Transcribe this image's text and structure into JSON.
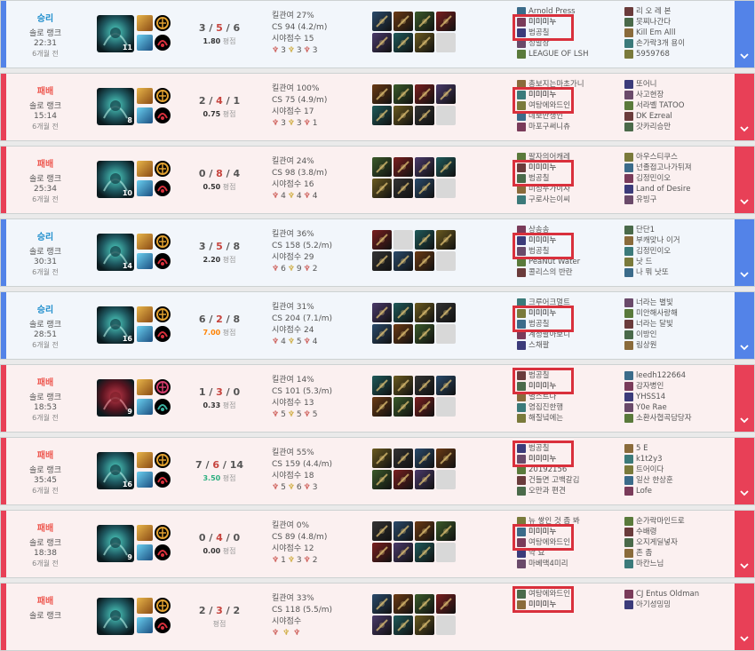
{
  "labels": {
    "kill_participation": "킬관여",
    "cs": "CS",
    "vision": "시야점수",
    "avg_suffix": "평점"
  },
  "colors": {
    "win": "#5383e8",
    "loss": "#e84057",
    "win_text": "#1f8ecd",
    "loss_text": "#ee5a52",
    "highlight": "#d9303c"
  },
  "matches": [
    {
      "result": "승리",
      "outcome": "win",
      "queue": "솔로 랭크",
      "duration": "22:31",
      "ago": "6개월 전",
      "level": "11",
      "champion_icon": "champion-icon",
      "kills": "3",
      "deaths": "5",
      "assists": "6",
      "kda_ratio": "1.80",
      "kda_tier": "normal",
      "kp": "27%",
      "cs": "94",
      "cs_per_min": "(4.2/m)",
      "vision_score": "15",
      "wards": [
        "3",
        "3",
        "3"
      ],
      "items": [
        "item-1",
        "item-2",
        "item-3",
        "item-4",
        "item-5",
        "item-6",
        "item-7",
        ""
      ],
      "team1": [
        {
          "name": "Arnold Press",
          "me": false
        },
        {
          "name": "미미미누",
          "me": true
        },
        {
          "name": "범공칠",
          "me": false
        },
        {
          "name": "성발장",
          "me": false
        },
        {
          "name": "LEAGUE OF LSH",
          "me": false
        }
      ],
      "team2": [
        {
          "name": "리 오 레 본",
          "me": false
        },
        {
          "name": "못찌나간다",
          "me": false
        },
        {
          "name": "Kill Em Alll",
          "me": false
        },
        {
          "name": "손가락3개 용이",
          "me": false
        },
        {
          "name": "5959768",
          "me": false
        }
      ],
      "highlight_team": 1,
      "highlight_rows": [
        1,
        2
      ]
    },
    {
      "result": "패배",
      "outcome": "loss",
      "queue": "솔로 랭크",
      "duration": "15:14",
      "ago": "6개월 전",
      "level": "8",
      "champion_icon": "champion-icon",
      "kills": "2",
      "deaths": "4",
      "assists": "1",
      "kda_ratio": "0.75",
      "kda_tier": "normal",
      "kp": "100%",
      "cs": "75",
      "cs_per_min": "(4.9/m)",
      "vision_score": "17",
      "wards": [
        "3",
        "3",
        "1"
      ],
      "items": [
        "item-1",
        "item-2",
        "item-3",
        "item-4",
        "item-5",
        "item-6",
        "item-7",
        ""
      ],
      "team1": [
        {
          "name": "총보지는마초가니",
          "me": false
        },
        {
          "name": "미미미누",
          "me": true
        },
        {
          "name": "여탕에와드인",
          "me": false
        },
        {
          "name": "데보만생인",
          "me": false
        },
        {
          "name": "마포구써니츄",
          "me": false
        }
      ],
      "team2": [
        {
          "name": "또어니",
          "me": false
        },
        {
          "name": "사고현장",
          "me": false
        },
        {
          "name": "서라벨 TATOO",
          "me": false
        },
        {
          "name": "DK Ezreal",
          "me": false
        },
        {
          "name": "갓카리승만",
          "me": false
        }
      ],
      "highlight_team": 1,
      "highlight_rows": [
        1,
        2
      ]
    },
    {
      "result": "패배",
      "outcome": "loss",
      "queue": "솔로 랭크",
      "duration": "25:34",
      "ago": "6개월 전",
      "level": "10",
      "champion_icon": "champion-icon",
      "kills": "0",
      "deaths": "8",
      "assists": "4",
      "kda_ratio": "0.50",
      "kda_tier": "normal",
      "kp": "24%",
      "cs": "98",
      "cs_per_min": "(3.8/m)",
      "vision_score": "16",
      "wards": [
        "4",
        "4",
        "4"
      ],
      "items": [
        "item-1",
        "item-2",
        "item-3",
        "item-4",
        "item-5",
        "item-6",
        "item-7",
        ""
      ],
      "team1": [
        {
          "name": "팔자의어캐레",
          "me": false
        },
        {
          "name": "미미미누",
          "me": true
        },
        {
          "name": "범공칠",
          "me": false
        },
        {
          "name": "미성누가이자",
          "me": false
        },
        {
          "name": "구로사는이씨",
          "me": false
        }
      ],
      "team2": [
        {
          "name": "아우스티쿠스",
          "me": false
        },
        {
          "name": "넌졸접고나가뒤져",
          "me": false
        },
        {
          "name": "김정민이오",
          "me": false
        },
        {
          "name": "Land of Desire",
          "me": false
        },
        {
          "name": "유빙구",
          "me": false
        }
      ],
      "highlight_team": 1,
      "highlight_rows": [
        1,
        2
      ]
    },
    {
      "result": "승리",
      "outcome": "win",
      "queue": "솔로 랭크",
      "duration": "30:31",
      "ago": "6개월 전",
      "level": "14",
      "champion_icon": "champion-icon",
      "kills": "3",
      "deaths": "5",
      "assists": "8",
      "kda_ratio": "2.20",
      "kda_tier": "normal",
      "kp": "36%",
      "cs": "158",
      "cs_per_min": "(5.2/m)",
      "vision_score": "29",
      "wards": [
        "6",
        "9",
        "2"
      ],
      "items": [
        "item-1",
        "",
        "item-3",
        "item-4",
        "item-5",
        "item-6",
        "item-7",
        ""
      ],
      "team1": [
        {
          "name": "상송송",
          "me": false
        },
        {
          "name": "미미미누",
          "me": true
        },
        {
          "name": "범공칠",
          "me": false
        },
        {
          "name": "PeaNut Water",
          "me": false
        },
        {
          "name": "콜리스의 반란",
          "me": false
        }
      ],
      "team2": [
        {
          "name": "단단1",
          "me": false
        },
        {
          "name": "부캐맞나 이거",
          "me": false
        },
        {
          "name": "김정민이오",
          "me": false
        },
        {
          "name": "낫 드",
          "me": false
        },
        {
          "name": "나 뭐 낫또",
          "me": false
        }
      ],
      "highlight_team": 1,
      "highlight_rows": [
        1,
        2
      ]
    },
    {
      "result": "승리",
      "outcome": "win",
      "queue": "솔로 랭크",
      "duration": "28:51",
      "ago": "6개월 전",
      "level": "16",
      "champion_icon": "champion-icon",
      "kills": "6",
      "deaths": "2",
      "assists": "8",
      "kda_ratio": "7.00",
      "kda_tier": "great",
      "kp": "31%",
      "cs": "204",
      "cs_per_min": "(7.1/m)",
      "vision_score": "24",
      "wards": [
        "4",
        "5",
        "4"
      ],
      "items": [
        "item-1",
        "item-2",
        "item-3",
        "item-4",
        "item-5",
        "item-6",
        "item-7",
        ""
      ],
      "team1": [
        {
          "name": "크루어크멀트",
          "me": false
        },
        {
          "name": "미미미누",
          "me": true
        },
        {
          "name": "범공칠",
          "me": false
        },
        {
          "name": "계정팔아보니",
          "me": false
        },
        {
          "name": "스채팔",
          "me": false
        }
      ],
      "team2": [
        {
          "name": "너라는 별빛",
          "me": false
        },
        {
          "name": "미안해사랑해",
          "me": false
        },
        {
          "name": "너라는 달빛",
          "me": false
        },
        {
          "name": "이방인",
          "me": false
        },
        {
          "name": "림상원",
          "me": false
        }
      ],
      "highlight_team": 1,
      "highlight_rows": [
        1,
        2
      ]
    },
    {
      "result": "패배",
      "outcome": "loss",
      "queue": "솔로 랭크",
      "duration": "18:53",
      "ago": "6개월 전",
      "level": "9",
      "champion_icon": "champion-icon",
      "kills": "1",
      "deaths": "3",
      "assists": "0",
      "kda_ratio": "0.33",
      "kda_tier": "normal",
      "kp": "14%",
      "cs": "101",
      "cs_per_min": "(5.3/m)",
      "vision_score": "13",
      "wards": [
        "5",
        "5",
        "5"
      ],
      "items": [
        "item-1",
        "item-2",
        "item-3",
        "item-4",
        "item-5",
        "item-6",
        "item-7",
        ""
      ],
      "team1": [
        {
          "name": "범공칠",
          "me": false
        },
        {
          "name": "미미미누",
          "me": true
        },
        {
          "name": "별스트나",
          "me": false
        },
        {
          "name": "염집진한행",
          "me": false
        },
        {
          "name": "해질녘에는",
          "me": false
        }
      ],
      "team2": [
        {
          "name": "leedh122664",
          "me": false
        },
        {
          "name": "감자병인",
          "me": false
        },
        {
          "name": "YHSS14",
          "me": false
        },
        {
          "name": "Y0e Rae",
          "me": false
        },
        {
          "name": "소환사협곡담당자",
          "me": false
        }
      ],
      "highlight_team": 1,
      "highlight_rows": [
        0,
        1
      ]
    },
    {
      "result": "패배",
      "outcome": "loss",
      "queue": "솔로 랭크",
      "duration": "35:45",
      "ago": "6개월 전",
      "level": "16",
      "champion_icon": "champion-icon",
      "kills": "7",
      "deaths": "6",
      "assists": "14",
      "kda_ratio": "3.50",
      "kda_tier": "good",
      "kp": "55%",
      "cs": "159",
      "cs_per_min": "(4.4/m)",
      "vision_score": "18",
      "wards": [
        "5",
        "6",
        "3"
      ],
      "items": [
        "item-1",
        "item-2",
        "item-3",
        "item-4",
        "item-5",
        "item-6",
        "item-7",
        ""
      ],
      "team1": [
        {
          "name": "범공칠",
          "me": false
        },
        {
          "name": "미미미누",
          "me": true
        },
        {
          "name": "20192156",
          "me": false
        },
        {
          "name": "건들면 고백갈김",
          "me": false
        },
        {
          "name": "오만과 편견",
          "me": false
        }
      ],
      "team2": [
        {
          "name": "5 E",
          "me": false
        },
        {
          "name": "k1t2y3",
          "me": false
        },
        {
          "name": "트어이다",
          "me": false
        },
        {
          "name": "일산 한상훈",
          "me": false
        },
        {
          "name": "Lofe",
          "me": false
        }
      ],
      "highlight_team": 1,
      "highlight_rows": [
        0,
        1
      ]
    },
    {
      "result": "패배",
      "outcome": "loss",
      "queue": "솔로 랭크",
      "duration": "18:38",
      "ago": "6개월 전",
      "level": "9",
      "champion_icon": "champion-icon",
      "kills": "0",
      "deaths": "4",
      "assists": "0",
      "kda_ratio": "0.00",
      "kda_tier": "normal",
      "kp": "0%",
      "cs": "89",
      "cs_per_min": "(4.8/m)",
      "vision_score": "12",
      "wards": [
        "1",
        "3",
        "2"
      ],
      "items": [
        "item-1",
        "item-2",
        "item-3",
        "item-4",
        "item-5",
        "item-6",
        "item-7",
        ""
      ],
      "team1": [
        {
          "name": "뉴 쌓인 것 좀 봐",
          "me": false
        },
        {
          "name": "미미미누",
          "me": true
        },
        {
          "name": "여탕에와드인",
          "me": false
        },
        {
          "name": "악 요",
          "me": false
        },
        {
          "name": "마베맥4미리",
          "me": false
        }
      ],
      "team2": [
        {
          "name": "순가락마인드로",
          "me": false
        },
        {
          "name": "수배령",
          "me": false
        },
        {
          "name": "오지게딜넣자",
          "me": false
        },
        {
          "name": "존 좀",
          "me": false
        },
        {
          "name": "마칸느님",
          "me": false
        }
      ],
      "highlight_team": 1,
      "highlight_rows": [
        1,
        2
      ]
    },
    {
      "result": "패배",
      "outcome": "loss",
      "queue": "솔로 랭크",
      "duration": "",
      "ago": "",
      "level": "",
      "champion_icon": "champion-icon",
      "kills": "2",
      "deaths": "3",
      "assists": "2",
      "kda_ratio": "",
      "kda_tier": "normal",
      "kp": "33%",
      "cs": "118",
      "cs_per_min": "(5.5/m)",
      "vision_score": "",
      "wards": [
        "",
        "",
        ""
      ],
      "items": [
        "item-1",
        "item-2",
        "item-3",
        "item-4",
        "item-5",
        "item-6",
        "item-7",
        ""
      ],
      "team1": [
        {
          "name": "여탕에와드인",
          "me": false
        },
        {
          "name": "미미미누",
          "me": true
        },
        {
          "name": "",
          "me": false
        },
        {
          "name": "",
          "me": false
        },
        {
          "name": "",
          "me": false
        }
      ],
      "team2": [
        {
          "name": "CJ Entus Oldman",
          "me": false
        },
        {
          "name": "아기성밍밍",
          "me": false
        },
        {
          "name": "",
          "me": false
        },
        {
          "name": "",
          "me": false
        },
        {
          "name": "",
          "me": false
        }
      ],
      "highlight_team": 1,
      "highlight_rows": [
        0,
        1
      ]
    }
  ]
}
